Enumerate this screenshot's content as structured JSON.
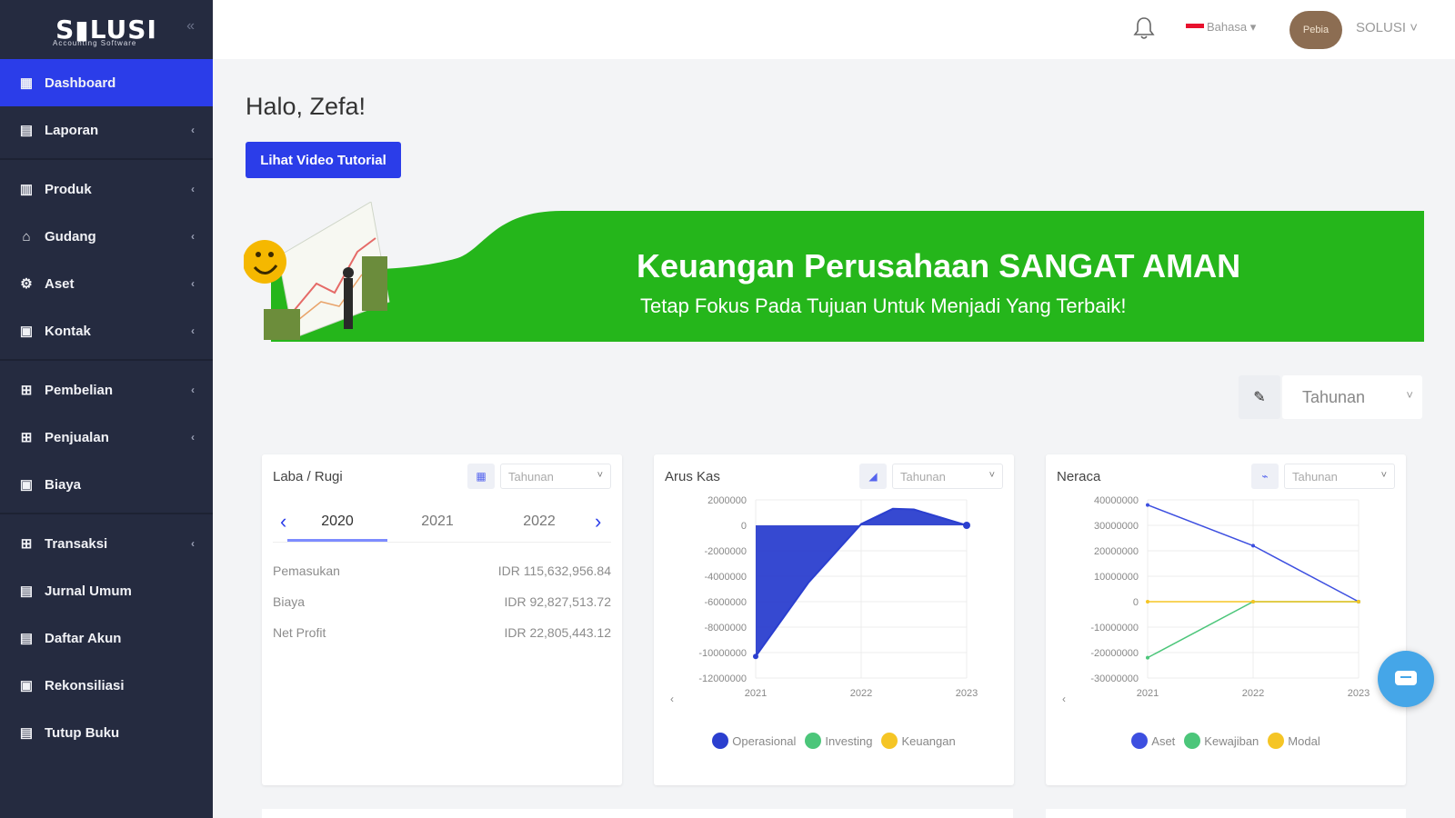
{
  "app": {
    "logo_text": "S▮LUSI",
    "logo_sub": "Accounting Software"
  },
  "sidebar": {
    "items": [
      {
        "label": "Dashboard",
        "icon": "dashboard-icon",
        "active": true
      },
      {
        "label": "Laporan",
        "icon": "report-icon",
        "chevron": true
      },
      {
        "label": "Produk",
        "icon": "product-icon",
        "chevron": true
      },
      {
        "label": "Gudang",
        "icon": "warehouse-icon",
        "chevron": true
      },
      {
        "label": "Aset",
        "icon": "asset-icon",
        "chevron": true
      },
      {
        "label": "Kontak",
        "icon": "contact-icon",
        "chevron": true
      },
      {
        "label": "Pembelian",
        "icon": "purchase-icon",
        "chevron": true
      },
      {
        "label": "Penjualan",
        "icon": "sales-icon",
        "chevron": true
      },
      {
        "label": "Biaya",
        "icon": "expense-icon",
        "chevron": false
      },
      {
        "label": "Transaksi",
        "icon": "transaction-icon",
        "chevron": true
      },
      {
        "label": "Jurnal Umum",
        "icon": "journal-icon",
        "chevron": false
      },
      {
        "label": "Daftar Akun",
        "icon": "accounts-icon",
        "chevron": false
      },
      {
        "label": "Rekonsiliasi",
        "icon": "reconcile-icon",
        "chevron": false
      },
      {
        "label": "Tutup Buku",
        "icon": "close-book-icon",
        "chevron": false
      }
    ]
  },
  "topbar": {
    "language": "Bahasa",
    "avatar_text": "Pebia",
    "user": "SOLUSI"
  },
  "main": {
    "greeting": "Halo, Zefa!",
    "tutorial_button": "Lihat Video Tutorial",
    "banner_title": "Keuangan Perusahaan SANGAT AMAN",
    "banner_subtitle": "Tetap Fokus Pada Tujuan Untuk Menjadi Yang Terbaik!",
    "period_value": "Tahunan"
  },
  "cards": {
    "laba_rugi": {
      "title": "Laba / Rugi",
      "select": "Tahunan",
      "years": [
        "2020",
        "2021",
        "2022"
      ],
      "rows": [
        {
          "label": "Pemasukan",
          "value": "IDR 115,632,956.84"
        },
        {
          "label": "Biaya",
          "value": "IDR 92,827,513.72"
        },
        {
          "label": "Net Profit",
          "value": "IDR 22,805,443.12"
        }
      ]
    },
    "arus_kas": {
      "title": "Arus Kas",
      "select": "Tahunan"
    },
    "neraca": {
      "title": "Neraca",
      "select": "Tahunan"
    }
  },
  "chart_data": [
    {
      "type": "area",
      "title": "Arus Kas",
      "x": [
        "2021",
        "2022",
        "2023"
      ],
      "ylim": [
        -12000000,
        2000000
      ],
      "yticks": [
        2000000,
        0,
        -2000000,
        -4000000,
        -6000000,
        -8000000,
        -10000000,
        -12000000
      ],
      "series": [
        {
          "name": "Operasional",
          "color": "#2b3fcf",
          "x": [
            "2021",
            "2021.5",
            "2022",
            "2022.3",
            "2022.5",
            "2023"
          ],
          "values": [
            -10300000,
            -4500000,
            100000,
            1300000,
            1250000,
            0
          ]
        },
        {
          "name": "Investing",
          "color": "#4cc67a",
          "values": []
        },
        {
          "name": "Keuangan",
          "color": "#f5c525",
          "values": []
        }
      ]
    },
    {
      "type": "line",
      "title": "Neraca",
      "x": [
        "2021",
        "2022",
        "2023"
      ],
      "ylim": [
        -30000000,
        40000000
      ],
      "yticks": [
        40000000,
        30000000,
        20000000,
        10000000,
        0,
        -10000000,
        -20000000,
        -30000000
      ],
      "series": [
        {
          "name": "Aset",
          "color": "#3d4fe0",
          "values": [
            38000000,
            22000000,
            0
          ]
        },
        {
          "name": "Kewajiban",
          "color": "#4cc67a",
          "values": [
            -22000000,
            0,
            0
          ]
        },
        {
          "name": "Modal",
          "color": "#f5c525",
          "values": [
            0,
            0,
            0
          ]
        }
      ]
    }
  ]
}
